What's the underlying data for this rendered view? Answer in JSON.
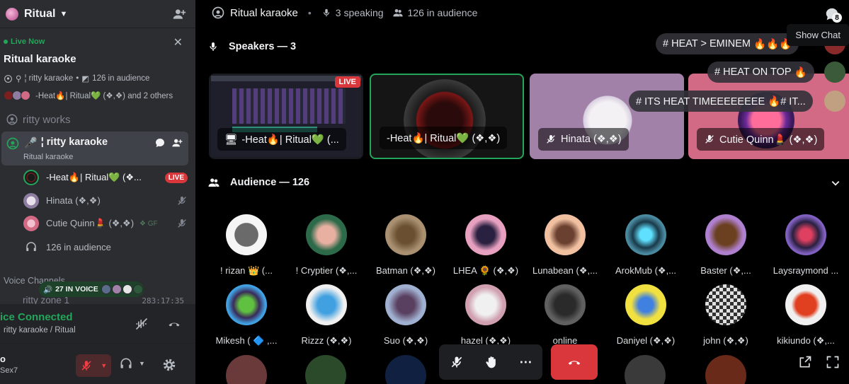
{
  "server": {
    "name": "Ritual"
  },
  "live_card": {
    "status": "Live Now",
    "title": "Ritual karaoke",
    "meta_channel": "¦ ritty karaoke",
    "meta_audience": "126 in audience",
    "meta_people": "-Heat🔥| Ritual💚 (❖,❖) and 2 others"
  },
  "channels": {
    "works": "ritty works",
    "karaoke": "¦ ritty karaoke",
    "karaoke_sub": "Ritual karaoke"
  },
  "members": [
    {
      "name": "-Heat🔥| Ritual💚 (❖...",
      "badge": "LIVE"
    },
    {
      "name": "Hinata (❖,❖)"
    },
    {
      "name": "Cutie Quinn💄 (❖,❖)",
      "tag": "GF"
    },
    {
      "name": "126 in audience"
    }
  ],
  "voice_section": {
    "header": "Voice Channels",
    "pill": "27 IN VOICE",
    "zone": "ritty zone 1",
    "zone_time": "283:17:35"
  },
  "voice_panel": {
    "status": "ice Connected",
    "sub": "ritty karaoke / Ritual"
  },
  "user_panel": {
    "name": "o",
    "tag": "Sex7"
  },
  "topbar": {
    "title": "Ritual karaoke",
    "speaking": "3 speaking",
    "audience": "126 in audience",
    "chat_badge": "8",
    "tooltip": "Show Chat"
  },
  "speakers": {
    "header": "Speakers — 3",
    "tiles": [
      {
        "label": "-Heat🔥| Ritual💚 (...",
        "live": "LIVE"
      },
      {
        "label": "-Heat🔥| Ritual💚 (❖,❖)"
      },
      {
        "label": "Hinata (❖,❖)"
      },
      {
        "label": "Cutie Quinn💄 (❖,❖)"
      }
    ]
  },
  "chat_bubbles": [
    "# HEAT > EMINEM",
    "# HEAT ON TOP",
    "# ITS HEAT TIMEEEEEEEE 🔥# IT..."
  ],
  "audience": {
    "header": "Audience — 126",
    "members": [
      "! rizan 👑 (...",
      "! Cryptier (❖,...",
      "Batman (❖,❖)",
      "LHEA 🌻 (❖,❖)",
      "Lunabean (❖,...",
      "ArokMub (❖,...",
      "Baster (❖,...",
      "Laysraymond ...",
      "Mikesh ( 🔷 ,...",
      "Rizzz (❖,❖)",
      "Suo (❖,❖)",
      "hazel (❖,❖)",
      "online",
      "Daniyel (❖,❖)",
      "john (❖,❖)",
      "kikiundo (❖,..."
    ]
  },
  "colors": {
    "accent_green": "#23a55a",
    "danger": "#da373c",
    "sidebar": "#2b2d31"
  }
}
